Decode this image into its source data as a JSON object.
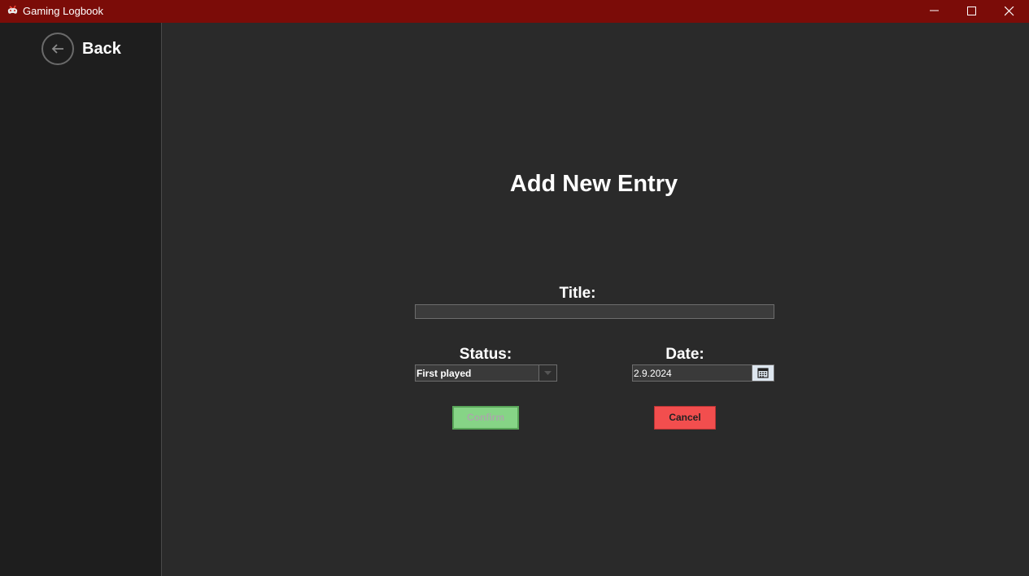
{
  "window": {
    "title": "Gaming Logbook"
  },
  "sidebar": {
    "back_label": "Back"
  },
  "form": {
    "heading": "Add New Entry",
    "title_label": "Title:",
    "title_value": "",
    "status_label": "Status:",
    "status_value": "First played",
    "date_label": "Date:",
    "date_value": "2.9.2024",
    "confirm_label": "Confirm",
    "cancel_label": "Cancel"
  },
  "colors": {
    "titlebar": "#7b0c08",
    "background": "#2a2a2a",
    "sidebar": "#1e1e1e",
    "confirm": "#86d486",
    "cancel": "#f24e4e"
  },
  "icons": [
    "app-icon",
    "back-arrow-icon",
    "minimize-icon",
    "maximize-icon",
    "close-icon",
    "chevron-down-icon",
    "calendar-icon"
  ]
}
